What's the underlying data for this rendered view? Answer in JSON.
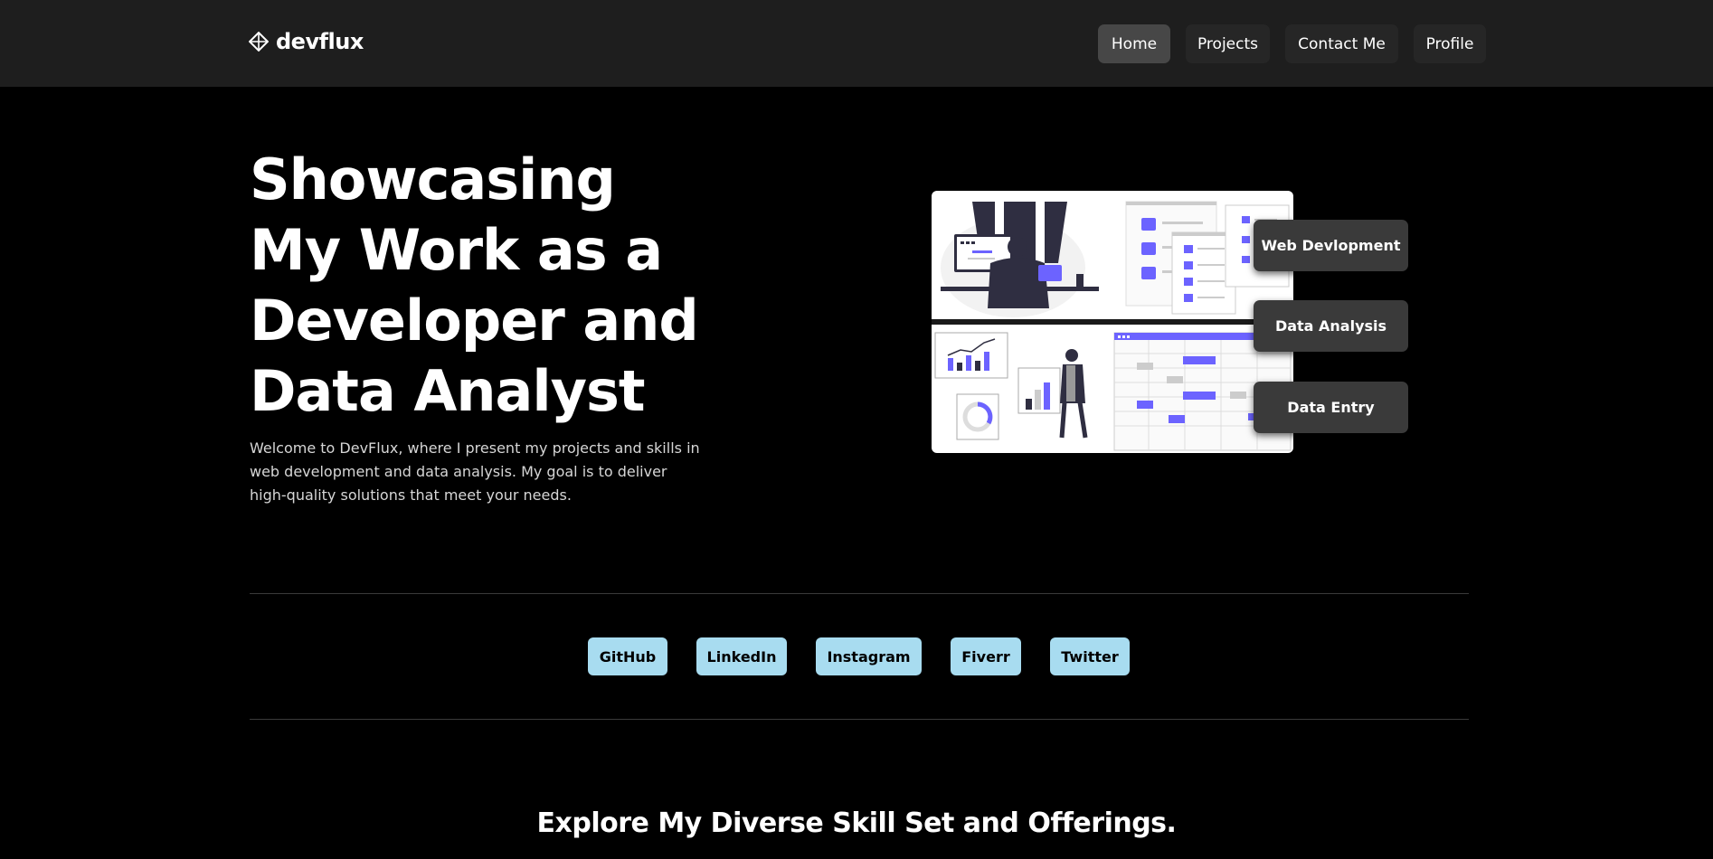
{
  "brand": {
    "name": "devflux",
    "icon": "diamond-logo-icon"
  },
  "nav": {
    "items": [
      {
        "label": "Home",
        "active": true
      },
      {
        "label": "Projects",
        "active": false
      },
      {
        "label": "Contact Me",
        "active": false
      },
      {
        "label": "Profile",
        "active": false
      }
    ]
  },
  "hero": {
    "title_lines": [
      "Showcasing",
      "My Work as a",
      "Developer and",
      "Data Analyst"
    ],
    "description": "Welcome to DevFlux, where I present my projects and skills in web development and data analysis. My goal is to deliver high-quality solutions that meet your needs."
  },
  "services": [
    "Web Devlopment",
    "Data Analysis",
    "Data Entry"
  ],
  "social": [
    "GitHub",
    "LinkedIn",
    "Instagram",
    "Fiverr",
    "Twitter"
  ],
  "skills_section": {
    "title": "Explore My Diverse Skill Set and Offerings."
  },
  "colors": {
    "navbar_bg": "#1e1e1e",
    "nav_active_bg": "#474747",
    "accent_purple": "#6c63ff",
    "social_bg": "#a8dcf0",
    "service_bg": "#3a3a3a"
  }
}
